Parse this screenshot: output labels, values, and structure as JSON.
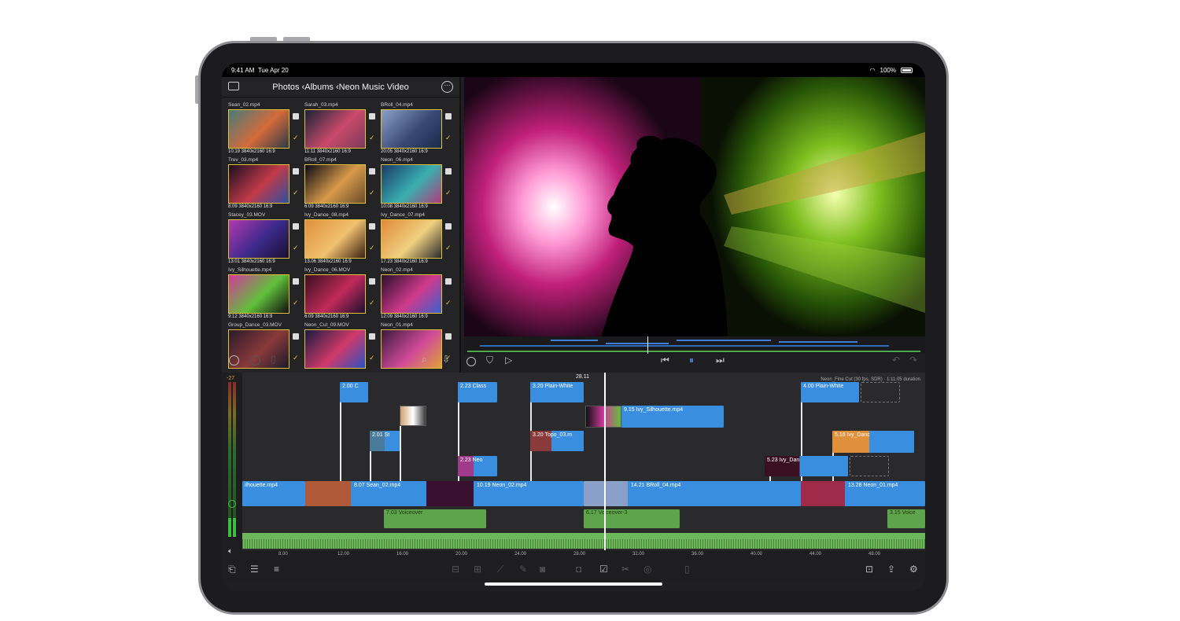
{
  "status": {
    "time": "9:41 AM",
    "date": "Tue Apr 20",
    "battery": "100%"
  },
  "browser": {
    "title": "Photos ‹Albums ‹Neon Music Video",
    "clips": [
      {
        "name": "Sean_02.mp4",
        "meta": "10:19 3840x2160 16:9",
        "colors": [
          "#4a7a7a",
          "#d46b3a",
          "#2a3a4a"
        ]
      },
      {
        "name": "Sarah_03.mp4",
        "meta": "11:11 3840x2160 16:9",
        "colors": [
          "#1a2236",
          "#c94a6a",
          "#7a3a5a"
        ]
      },
      {
        "name": "BRoll_04.mp4",
        "meta": "20:05 3840x2160 16:9",
        "colors": [
          "#8aa0c8",
          "#3a4a78",
          "#1a2a4a"
        ]
      },
      {
        "name": "Trev_03.mp4",
        "meta": "8:09 3840x2160 16:9",
        "colors": [
          "#1a1020",
          "#c23a4a",
          "#2a50a0"
        ]
      },
      {
        "name": "BRoll_07.mp4",
        "meta": "6:09 3840x2160 16:9",
        "colors": [
          "#0a0a12",
          "#d89a4a",
          "#6a4a2a"
        ]
      },
      {
        "name": "Neon_06.mp4",
        "meta": "10:08 3840x2160 16:9",
        "colors": [
          "#1a3a6a",
          "#3ab0b0",
          "#b03a7a"
        ]
      },
      {
        "name": "Stacey_03.MOV",
        "meta": "13:01 3840x2160 16:9",
        "colors": [
          "#b03ab0",
          "#3a2a8a",
          "#1a1030"
        ]
      },
      {
        "name": "Ivy_Dance_08.mp4",
        "meta": "13.06 3840x2160 16:9",
        "colors": [
          "#e0903a",
          "#f0c070",
          "#3a2010"
        ]
      },
      {
        "name": "Ivy_Dance_07.mp4",
        "meta": "17.23 3840x2160 16:9",
        "colors": [
          "#e08a3a",
          "#f0d080",
          "#2a2a2a"
        ]
      },
      {
        "name": "Ivy_Silhouette.mp4",
        "meta": "9:12 3840x2160 16:9",
        "colors": [
          "#d03a9a",
          "#60c03a",
          "#101010"
        ]
      },
      {
        "name": "Ivy_Dance_06.MOV",
        "meta": "6:09 3840x2160 16:9",
        "colors": [
          "#3a1020",
          "#c02a5a",
          "#1a1030"
        ]
      },
      {
        "name": "Neon_02.mp4",
        "meta": "12:09 3840x2160 16:9",
        "colors": [
          "#2a1030",
          "#d03a8a",
          "#3a60d0"
        ]
      },
      {
        "name": "Group_Dance_03.MOV",
        "meta": "",
        "colors": [
          "#2a1a2a",
          "#8a3a3a",
          "#1a1a2a"
        ]
      },
      {
        "name": "Neon_Cut_09.MOV",
        "meta": "",
        "colors": [
          "#1a1a40",
          "#d03a6a",
          "#2a50c0"
        ]
      },
      {
        "name": "Neon_01.mp4",
        "meta": "",
        "colors": [
          "#3a1a3a",
          "#d04a9a",
          "#e0a03a"
        ]
      }
    ]
  },
  "timeline": {
    "timecode": "28.11",
    "project_info": "Neon_Fine Cut (30 fps, SDR) · 1:11.05 duration",
    "db_level": "-27",
    "ruler": [
      "8.00",
      "12.00",
      "16.00",
      "20.00",
      "24.00",
      "28.00",
      "32.00",
      "36.00",
      "40.00",
      "44.00",
      "48.00"
    ],
    "titles": [
      {
        "label": "2.00  C"
      },
      {
        "label": "2.23  Class"
      },
      {
        "label": "3.20  Plain-White"
      },
      {
        "label": "4.00  Plain-White"
      }
    ],
    "connected": [
      {
        "label": "9.15  Ivy_Silhouette.mp4"
      },
      {
        "label": "2.01  St"
      },
      {
        "label": "3.20  Topo_03.m"
      },
      {
        "label": "2.23  Neo"
      },
      {
        "label": "5.16  Ivy_Danc"
      },
      {
        "label": "5.23  Ivy_Dan"
      }
    ],
    "primary": [
      {
        "label": "ilhouette.mp4"
      },
      {
        "label": "8.07  Sean_02.mp4"
      },
      {
        "label": "10.19  Neon_02.mp4"
      },
      {
        "label": "14.21  BRoll_04.mp4"
      },
      {
        "label": "13.28  Neon_01.mp4"
      }
    ],
    "voiceover": [
      {
        "label": "7.03  Voiceover"
      },
      {
        "label": "6.17  Voiceover-3"
      },
      {
        "label": "3.15  Voice"
      }
    ]
  }
}
